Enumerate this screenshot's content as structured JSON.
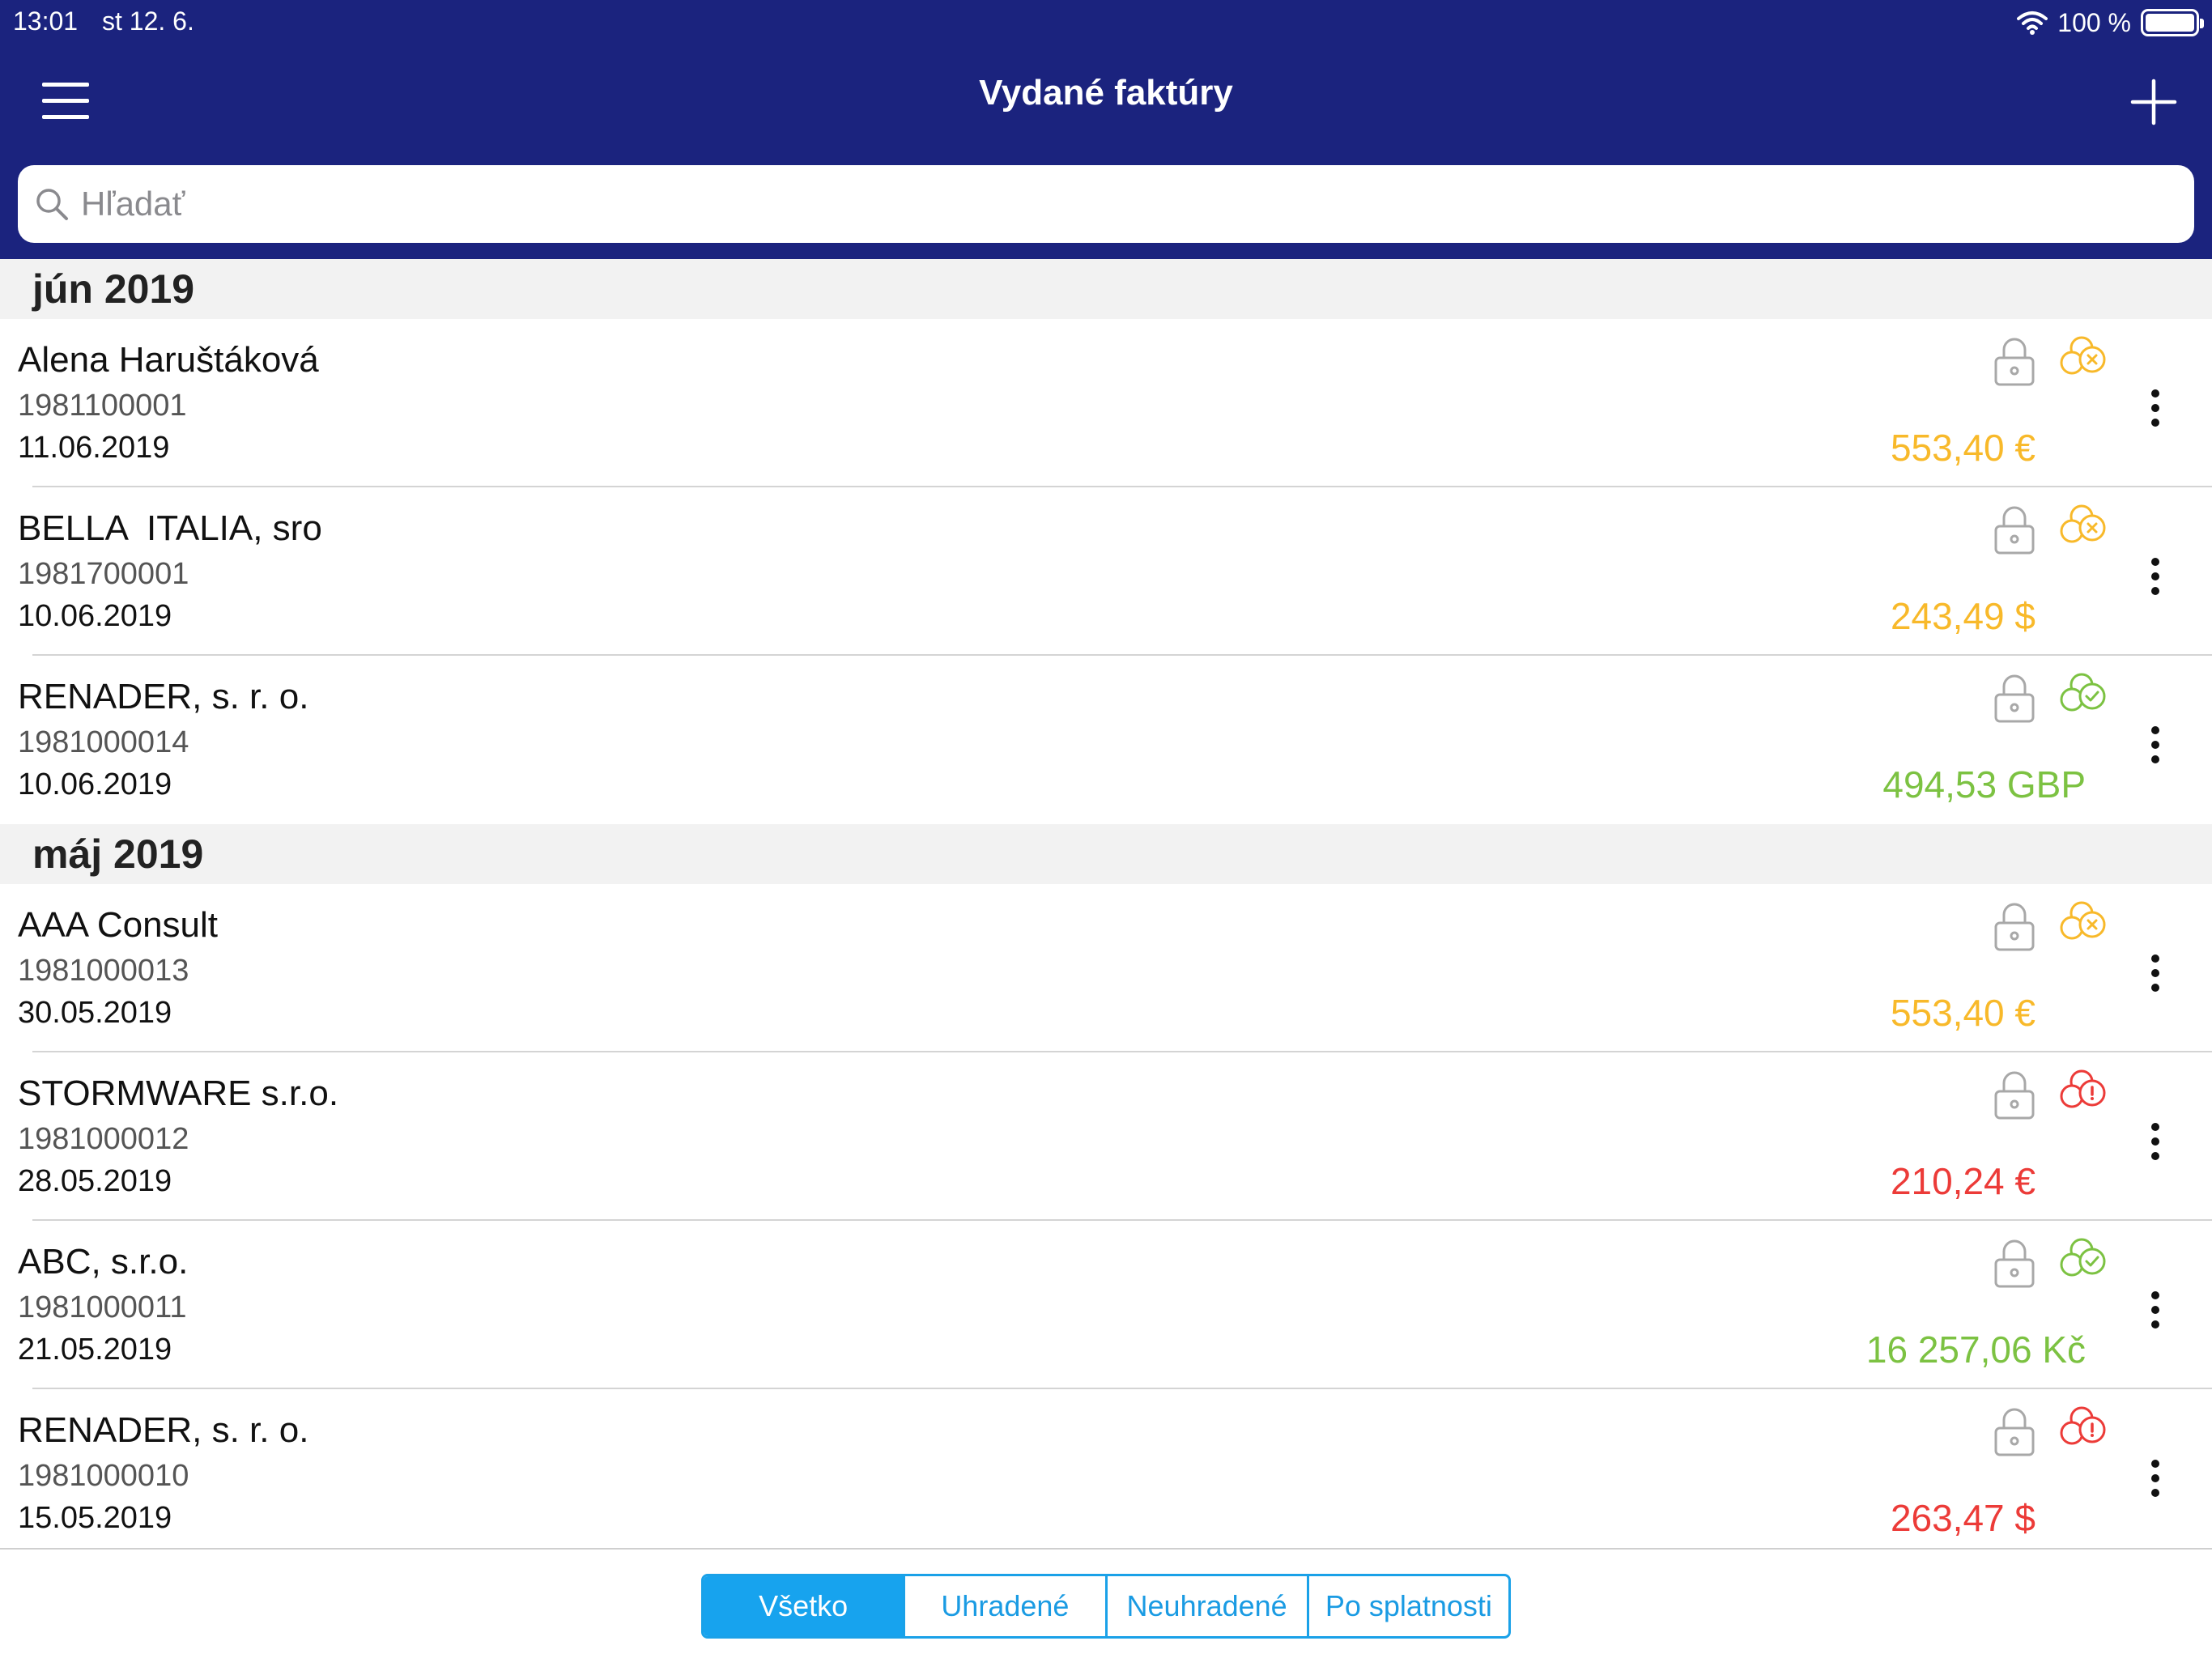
{
  "status_bar": {
    "time": "13:01",
    "date": "st 12. 6.",
    "battery": "100 %"
  },
  "nav": {
    "title": "Vydané faktúry"
  },
  "search": {
    "placeholder": "Hľadať"
  },
  "colors": {
    "nav_bg": "#1b237e",
    "yellow": "#f8b92a",
    "green": "#7cc242",
    "red": "#ec3b38",
    "accent": "#17a3ee"
  },
  "sections": [
    {
      "title": "jún 2019",
      "items": [
        {
          "name": "Alena Haruštáková",
          "number": "1981100001",
          "date": "11.06.2019",
          "amount": "553,40 €",
          "status": "unpaid",
          "status_icon": "coins-x-icon"
        },
        {
          "name": "BELLA  ITALIA, sro",
          "number": "1981700001",
          "date": "10.06.2019",
          "amount": "243,49 $",
          "status": "unpaid",
          "status_icon": "coins-x-icon"
        },
        {
          "name": "RENADER, s. r. o.",
          "number": "1981000014",
          "date": "10.06.2019",
          "amount": "494,53 GBP",
          "status": "paid",
          "status_icon": "coins-check-icon"
        }
      ]
    },
    {
      "title": "máj 2019",
      "items": [
        {
          "name": "AAA Consult",
          "number": "1981000013",
          "date": "30.05.2019",
          "amount": "553,40 €",
          "status": "unpaid",
          "status_icon": "coins-x-icon"
        },
        {
          "name": "STORMWARE s.r.o.",
          "number": "1981000012",
          "date": "28.05.2019",
          "amount": "210,24 €",
          "status": "overdue",
          "status_icon": "coins-alert-icon"
        },
        {
          "name": "ABC, s.r.o.",
          "number": "1981000011",
          "date": "21.05.2019",
          "amount": "16 257,06 Kč",
          "status": "paid",
          "status_icon": "coins-check-icon"
        },
        {
          "name": "RENADER, s. r. o.",
          "number": "1981000010",
          "date": "15.05.2019",
          "amount": "263,47 $",
          "status": "overdue",
          "status_icon": "coins-alert-icon"
        }
      ]
    }
  ],
  "filters": {
    "all": "Všetko",
    "paid": "Uhradené",
    "unpaid": "Neuhradené",
    "overdue": "Po splatnosti",
    "selected": "Všetko"
  }
}
